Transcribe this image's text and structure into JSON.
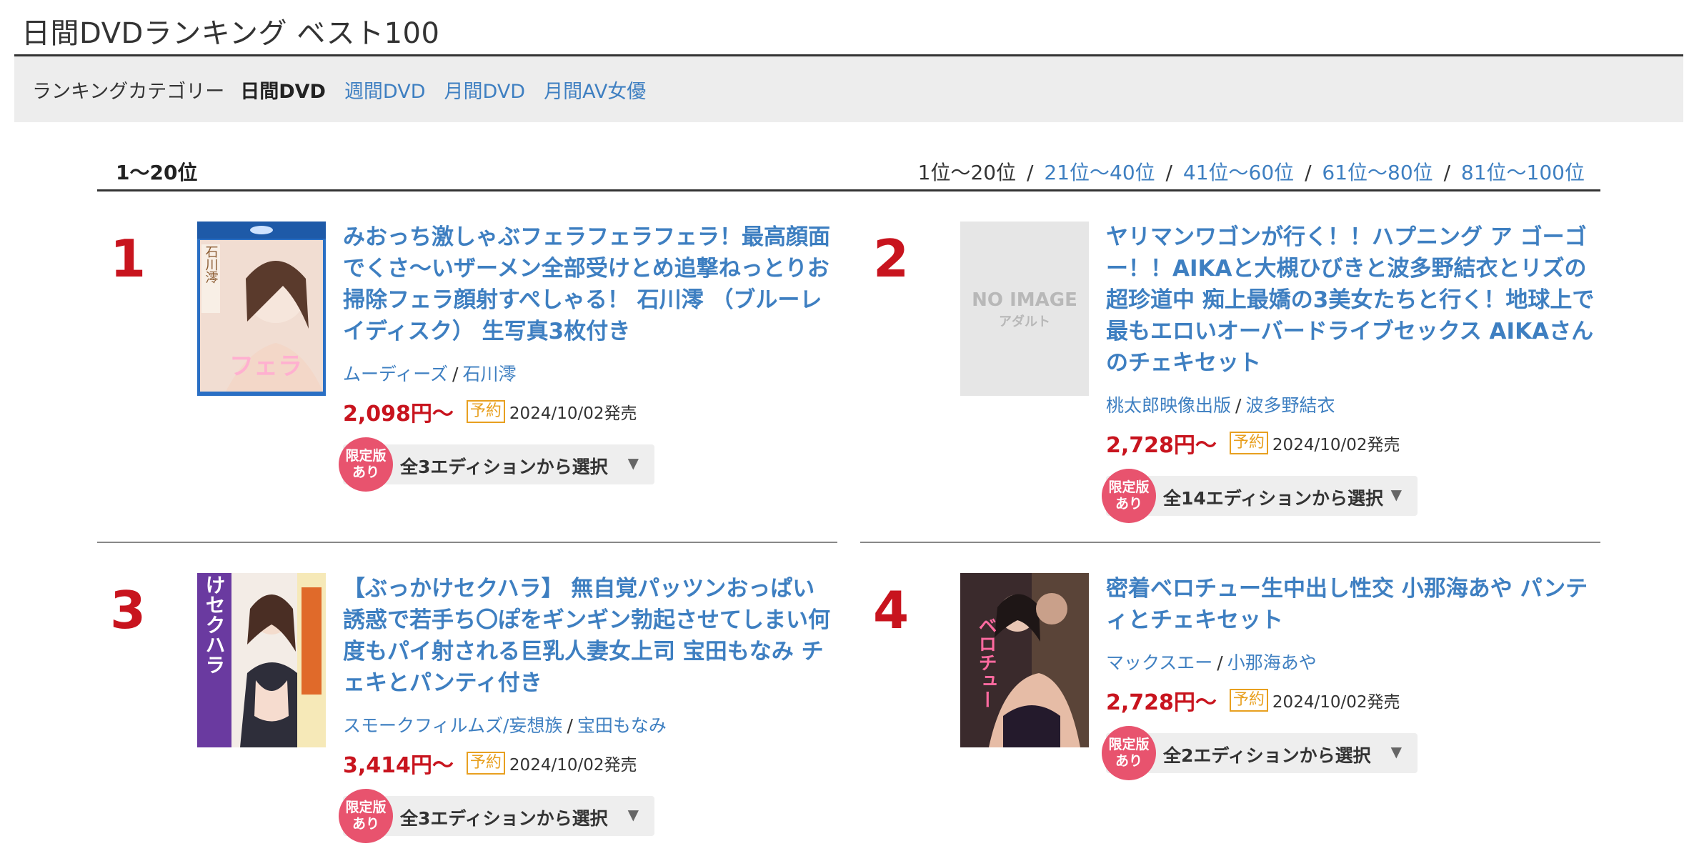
{
  "page": {
    "title": "日間DVDランキング ベスト100"
  },
  "category_bar": {
    "label": "ランキングカテゴリー",
    "current": "日間DVD",
    "links": [
      "週間DVD",
      "月間DVD",
      "月間AV女優"
    ]
  },
  "range": {
    "current_title": "1〜20位",
    "current_nav": "1位〜20位",
    "links": [
      "21位〜40位",
      "41位〜60位",
      "61位〜80位",
      "81位〜100位"
    ],
    "separator": "/"
  },
  "colors": {
    "accent_link": "#3e7fc1",
    "rank_red": "#c8141e",
    "reserve_orange": "#e8a020",
    "limited_pink": "#e8536e"
  },
  "items": [
    {
      "rank": "1",
      "title": "みおっち激しゃぶフェラフェラフェラ！最高顔面でくさ〜いザーメン全部受けとめ追撃ねっとりお掃除フェラ顔射すぺしゃる！ 石川澪 （ブルーレイディスク） 生写真3枚付き",
      "maker": "ムーディーズ",
      "actress": "石川澪",
      "price": "2,098円〜",
      "badge": "予約",
      "release": "2024/10/02発売",
      "limited": "限定版あり",
      "limited_line1": "限定版",
      "limited_line2": "あり",
      "edition": "全3エディションから選択",
      "thumb": {
        "type": "cover-bluray",
        "jacket_text": "石川澪",
        "jacket_sub": "フェラ"
      }
    },
    {
      "rank": "2",
      "title": "ヤリマンワゴンが行く！！ハプニング ア ゴーゴー！！AIKAと大槻ひびきと波多野結衣とリズの超珍道中 痴上最嬌の3美女たちと行く！地球上で最もエロいオーバードライブセックス AIKAさんのチェキセット",
      "maker": "桃太郎映像出版",
      "actress": "波多野結衣",
      "price": "2,728円〜",
      "badge": "予約",
      "release": "2024/10/02発売",
      "limited": "限定版あり",
      "limited_line1": "限定版",
      "limited_line2": "あり",
      "edition": "全14エディションから選択",
      "thumb": {
        "type": "no-image",
        "line1": "NO IMAGE",
        "line2": "アダルト"
      }
    },
    {
      "rank": "3",
      "title": "【ぶっかけセクハラ】 無自覚パッツンおっぱい誘惑で若手ち〇ぽをギンギン勃起させてしまい何度もパイ射される巨乳人妻女上司 宝田もなみ チェキとパンティ付き",
      "maker": "スモークフィルムズ/妄想族",
      "actress": "宝田もなみ",
      "price": "3,414円〜",
      "badge": "予約",
      "release": "2024/10/02発売",
      "limited": "限定版あり",
      "limited_line1": "限定版",
      "limited_line2": "あり",
      "edition": "全3エディションから選択",
      "thumb": {
        "type": "cover-dvd",
        "jacket_text": "ぶっかけセクハラ"
      }
    },
    {
      "rank": "4",
      "title": "密着ベロチュー生中出し性交 小那海あや パンティとチェキセット",
      "maker": "マックスエー",
      "actress": "小那海あや",
      "price": "2,728円〜",
      "badge": "予約",
      "release": "2024/10/02発売",
      "limited": "限定版あり",
      "limited_line1": "限定版",
      "limited_line2": "あり",
      "edition": "全2エディションから選択",
      "thumb": {
        "type": "cover-dark",
        "jacket_text": "ベロチュー"
      }
    }
  ]
}
